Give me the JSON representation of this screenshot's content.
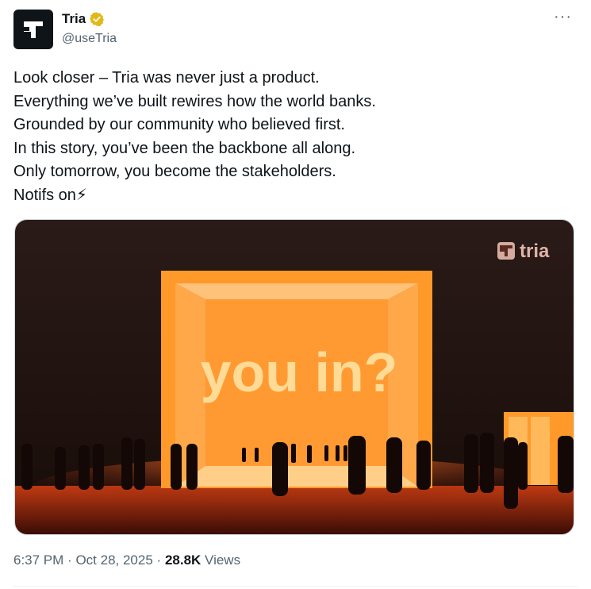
{
  "author": {
    "display_name": "Tria",
    "handle": "@useTria",
    "avatar_icon": "tria-logo-icon",
    "verified_icon": "gold-verified-badge-icon",
    "verified_color": "#e2b719"
  },
  "more_icon": "more-dots-icon",
  "more_label": "···",
  "tweet": {
    "lines": [
      "Look closer – Tria was never just a product.",
      "Everything we’ve built rewires how the world banks.",
      "Grounded by our community who believed first.",
      "In this story, you’ve been the backbone all along.",
      "Only tomorrow, you become the stakeholders.",
      "Notifs on⚡"
    ]
  },
  "media": {
    "overlay_text": "you in?",
    "watermark_text": "tria",
    "accent_color": "#ff8a1a"
  },
  "meta": {
    "time": "6:37 PM",
    "separator": "·",
    "date": "Oct 28, 2025",
    "views_count": "28.8K",
    "views_label": "Views"
  }
}
